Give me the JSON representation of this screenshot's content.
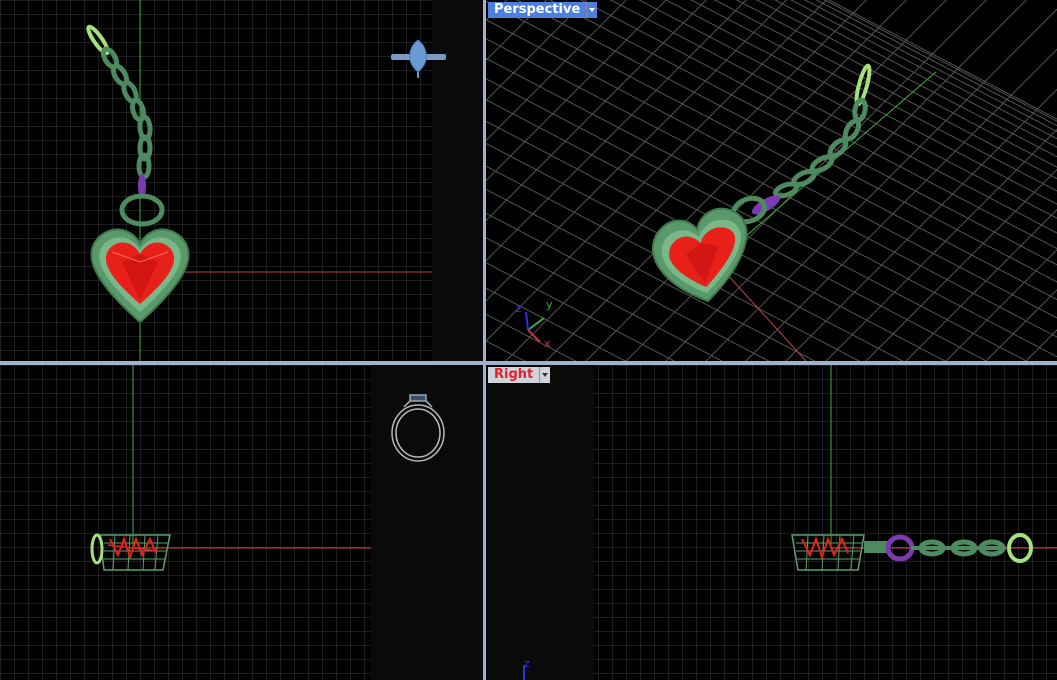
{
  "viewports": {
    "top_left": {
      "label": ""
    },
    "top_right": {
      "label": "Perspective",
      "active": true
    },
    "bottom_left": {
      "label": ""
    },
    "bottom_right": {
      "label": "Right"
    }
  },
  "axis_gizmo": {
    "x": "x",
    "y": "y",
    "z": "z"
  },
  "colors": {
    "background": "#000000",
    "grid_minor": "#3a3a3a",
    "grid_major": "#505050",
    "x_axis": "#b84545",
    "y_axis": "#3fae3f",
    "z_axis": "#2a2acc",
    "heart_gem": "#e8201a",
    "setting_metal": "#5a9a6a",
    "chain": "#4d8a60",
    "jump_ring": "#7a3ab0",
    "clasp": "#a6e07a",
    "viewport_border": "#9fb3cc",
    "active_label": "#4d7fe0"
  },
  "icons": {
    "top_left_thumbnail": "gem-ring-icon",
    "bottom_left_thumbnail": "ring-wireframe-icon",
    "menu_arrow": "chevron-down-icon"
  }
}
